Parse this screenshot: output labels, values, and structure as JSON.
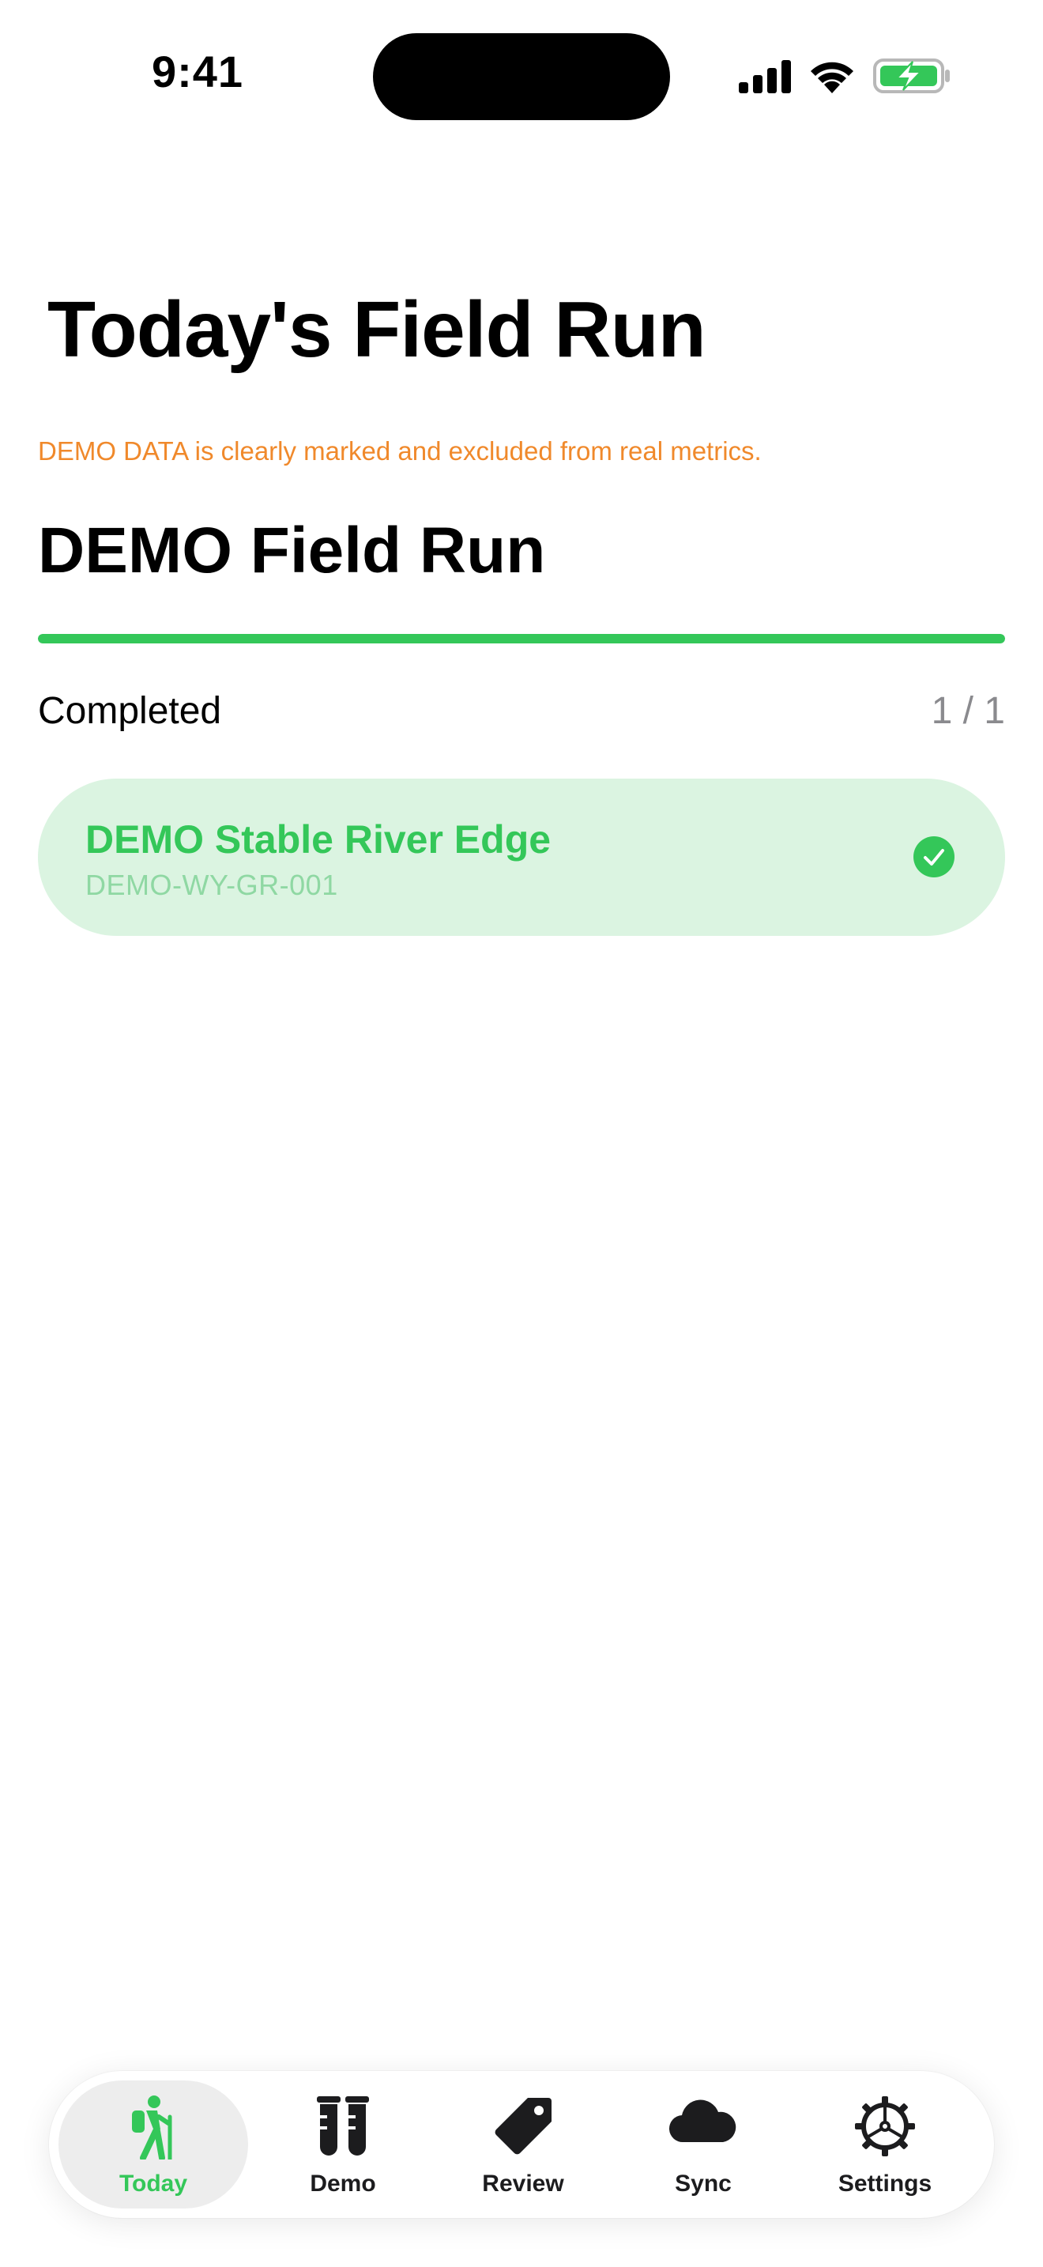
{
  "status_bar": {
    "time": "9:41"
  },
  "header": {
    "title": "Today's Field Run",
    "demo_notice": "DEMO DATA is clearly marked and excluded from real metrics."
  },
  "run": {
    "title": "DEMO Field Run",
    "progress_fraction": 1.0,
    "status_label": "Completed",
    "count_text": "1 / 1"
  },
  "sites": [
    {
      "name": "DEMO Stable River Edge",
      "code": "DEMO-WY-GR-001",
      "status_icon": "checkmark-circle-icon"
    }
  ],
  "tab_bar": {
    "tabs": [
      {
        "label": "Today",
        "icon": "hiking-icon",
        "active": true
      },
      {
        "label": "Demo",
        "icon": "test-tubes-icon",
        "active": false
      },
      {
        "label": "Review",
        "icon": "tag-icon",
        "active": false
      },
      {
        "label": "Sync",
        "icon": "cloud-icon",
        "active": false
      },
      {
        "label": "Settings",
        "icon": "gear-icon",
        "active": false
      }
    ]
  },
  "colors": {
    "accent": "#34c759",
    "warning": "#f0892b",
    "card_background": "#dbf4e1"
  }
}
